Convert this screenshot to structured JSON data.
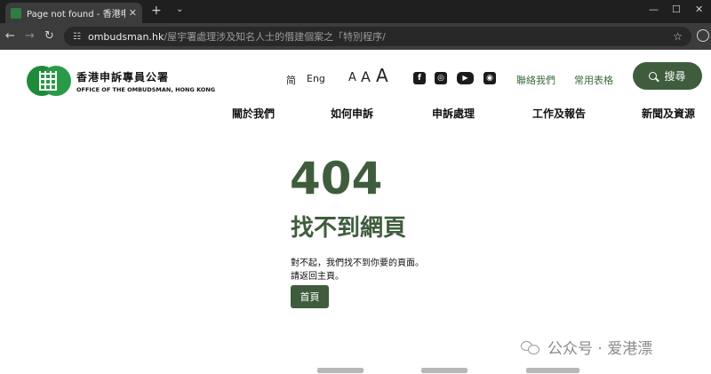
{
  "browser": {
    "tab_title": "Page not found - 香港申訴專員公",
    "tab_close": "✕",
    "new_tab": "+",
    "tab_menu": "⌄",
    "url_host": "ombudsman.hk",
    "url_path": "/屋宇署處理涉及知名人士的僭建個案之「特別程序/"
  },
  "logo": {
    "name_zh": "香港申訴專員公署",
    "name_en": "OFFICE OF THE OMBUDSMAN, HONG KONG"
  },
  "header": {
    "lang_sc": "简",
    "lang_en": "Eng",
    "font_small": "A",
    "font_medium": "A",
    "font_large": "A",
    "social_facebook": "f",
    "social_instagram": "◎",
    "social_youtube": "▶",
    "social_rss": "◉",
    "contact_us": "聯絡我們",
    "common_forms": "常用表格",
    "search_label": "搜尋"
  },
  "nav": {
    "items": [
      "關於我們",
      "如何申訴",
      "申訴處理",
      "工作及報告",
      "新聞及資源"
    ]
  },
  "error": {
    "code": "404",
    "title": "找不到網頁",
    "message": "對不起，我們找不到你要的頁面。",
    "message2": "請返回主頁。",
    "home_button": "首頁"
  },
  "watermark": {
    "text": "公众号 · 爱港漂"
  },
  "colors": {
    "brand_green": "#3f5d3c",
    "logo_green": "#1e8a3a",
    "link_green": "#3d6b3e"
  }
}
